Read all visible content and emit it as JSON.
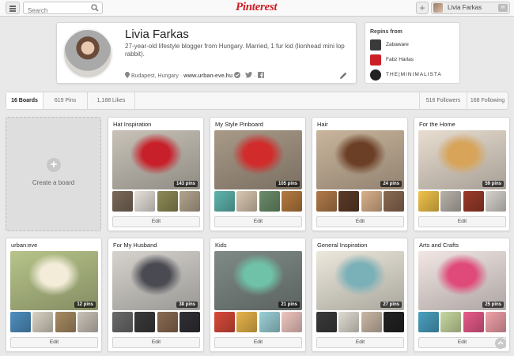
{
  "topbar": {
    "search_placeholder": "Search",
    "logo": "Pinterest",
    "add_label": "+",
    "user_name": "Livia Farkas"
  },
  "profile": {
    "name": "Livia Farkas",
    "bio": "27-year-old lifestyle blogger from Hungary. Married, 1 fur kid (lionhead mini lop rabbit).",
    "location": "Budapest, Hungary",
    "separator": " · ",
    "website": "www.urban-eve.hu"
  },
  "repins": {
    "heading": "Repins from",
    "items": [
      {
        "name": "Zabaware",
        "color": "#3a3a3a"
      },
      {
        "name": "Fabz Harlas",
        "color": "#cb2027"
      },
      {
        "name": "THE|MINIMALISTA",
        "color": "#222222"
      }
    ]
  },
  "stats": {
    "boards": "16 Boards",
    "pins": "619 Pins",
    "likes": "1,188 Likes",
    "followers": "516 Followers",
    "following": "168 Following"
  },
  "create_board": {
    "label": "Create a board",
    "plus": "+"
  },
  "edit_label": "Edit",
  "boards": [
    {
      "title": "Hat Inspiration",
      "pins": "143 pins",
      "cover": "#c8c2b8",
      "accent": "#c8202a",
      "thumbs": [
        "#7a6a5a",
        "#e6e1da",
        "#8e8a55",
        "#b3a58f"
      ]
    },
    {
      "title": "My Style Pinboard",
      "pins": "105 pins",
      "cover": "#a99a88",
      "accent": "#d12b2b",
      "thumbs": [
        "#5fb5ad",
        "#d9c7b0",
        "#6b8d6a",
        "#b57a3f"
      ]
    },
    {
      "title": "Hair",
      "pins": "24 pins",
      "cover": "#c9b59c",
      "accent": "#6b3f26",
      "thumbs": [
        "#b07a4a",
        "#5c3a28",
        "#d9b08a",
        "#8a6a52"
      ]
    },
    {
      "title": "For the Home",
      "pins": "59 pins",
      "cover": "#e8ddd0",
      "accent": "#d7a45a",
      "thumbs": [
        "#f0c24a",
        "#b7b2aa",
        "#9a3b2a",
        "#d6d2cc"
      ]
    },
    {
      "title": "urban:eve",
      "pins": "12 pins",
      "cover": "#b7c48a",
      "accent": "#f2ecd8",
      "thumbs": [
        "#4f8fc0",
        "#d8d2c2",
        "#a88b62",
        "#c9c2b8"
      ]
    },
    {
      "title": "For My Husband",
      "pins": "38 pins",
      "cover": "#d6d3ce",
      "accent": "#4a4a52",
      "thumbs": [
        "#6b6b6b",
        "#3a3a3a",
        "#8a6a52",
        "#2f2f35"
      ]
    },
    {
      "title": "Kids",
      "pins": "21 pins",
      "cover": "#7f8a86",
      "accent": "#6fc2a8",
      "thumbs": [
        "#d84a3a",
        "#e8b44a",
        "#9ad0d6",
        "#f0c6c0"
      ]
    },
    {
      "title": "General Inspiration",
      "pins": "27 pins",
      "cover": "#ece8dc",
      "accent": "#7ab0b8",
      "thumbs": [
        "#3a3a3a",
        "#e0dcd2",
        "#c9b8a5",
        "#222222"
      ]
    },
    {
      "title": "Arts and Crafts",
      "pins": "25 pins",
      "cover": "#f1e6e4",
      "accent": "#e04a7a",
      "thumbs": [
        "#4aa0c0",
        "#c8d8a0",
        "#e85a8a",
        "#f0a0a8"
      ]
    }
  ]
}
